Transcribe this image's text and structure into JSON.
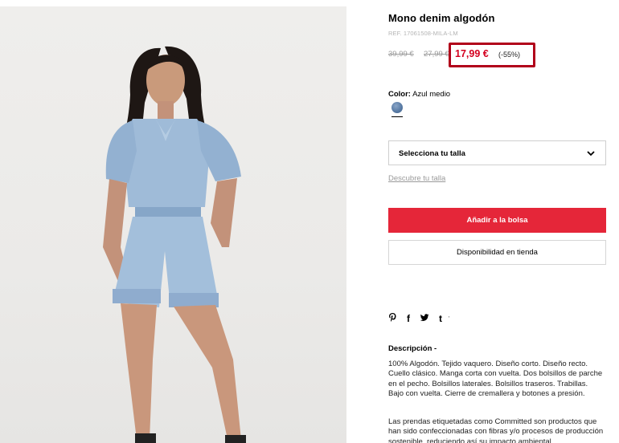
{
  "product": {
    "title": "Mono denim algodón",
    "ref": "REF. 17061508-MILA-LM",
    "old_price_1": "39,99 €",
    "old_price_2": "27,99 €",
    "price": "17,99 €",
    "discount": "(-55%)",
    "color_label": "Color:",
    "color_value": "Azul medio"
  },
  "size": {
    "select_label": "Selecciona tu talla",
    "guide_link": "Descubre tu talla"
  },
  "actions": {
    "add_to_bag": "Añadir a la bolsa",
    "store_availability": "Disponibilidad en tienda"
  },
  "social": {
    "icons": [
      "pinterest-icon",
      "facebook-icon",
      "twitter-icon",
      "tumblr-icon"
    ],
    "pinterest": "℗",
    "facebook": "f",
    "twitter": "🐦",
    "tumblr": "t",
    "extra": "'"
  },
  "description": {
    "title": "Descripción -",
    "body": "100% Algodón. Tejido vaquero. Diseño corto. Diseño recto. Cuello clásico. Manga corta con vuelta. Dos bolsillos de parche en el pecho. Bolsillos laterales. Bolsillos traseros. Trabillas. Bajo con vuelta. Cierre de cremallera y botones a presión.",
    "body2": "Las prendas etiquetadas como Committed son productos que han sido confeccionadas con fibras y/o procesos de producción sostenible, reduciendo así su impacto ambiental."
  },
  "colors": {
    "add_button": "#e52639",
    "price": "#d4001f",
    "highlight_border": "#b1001a"
  }
}
